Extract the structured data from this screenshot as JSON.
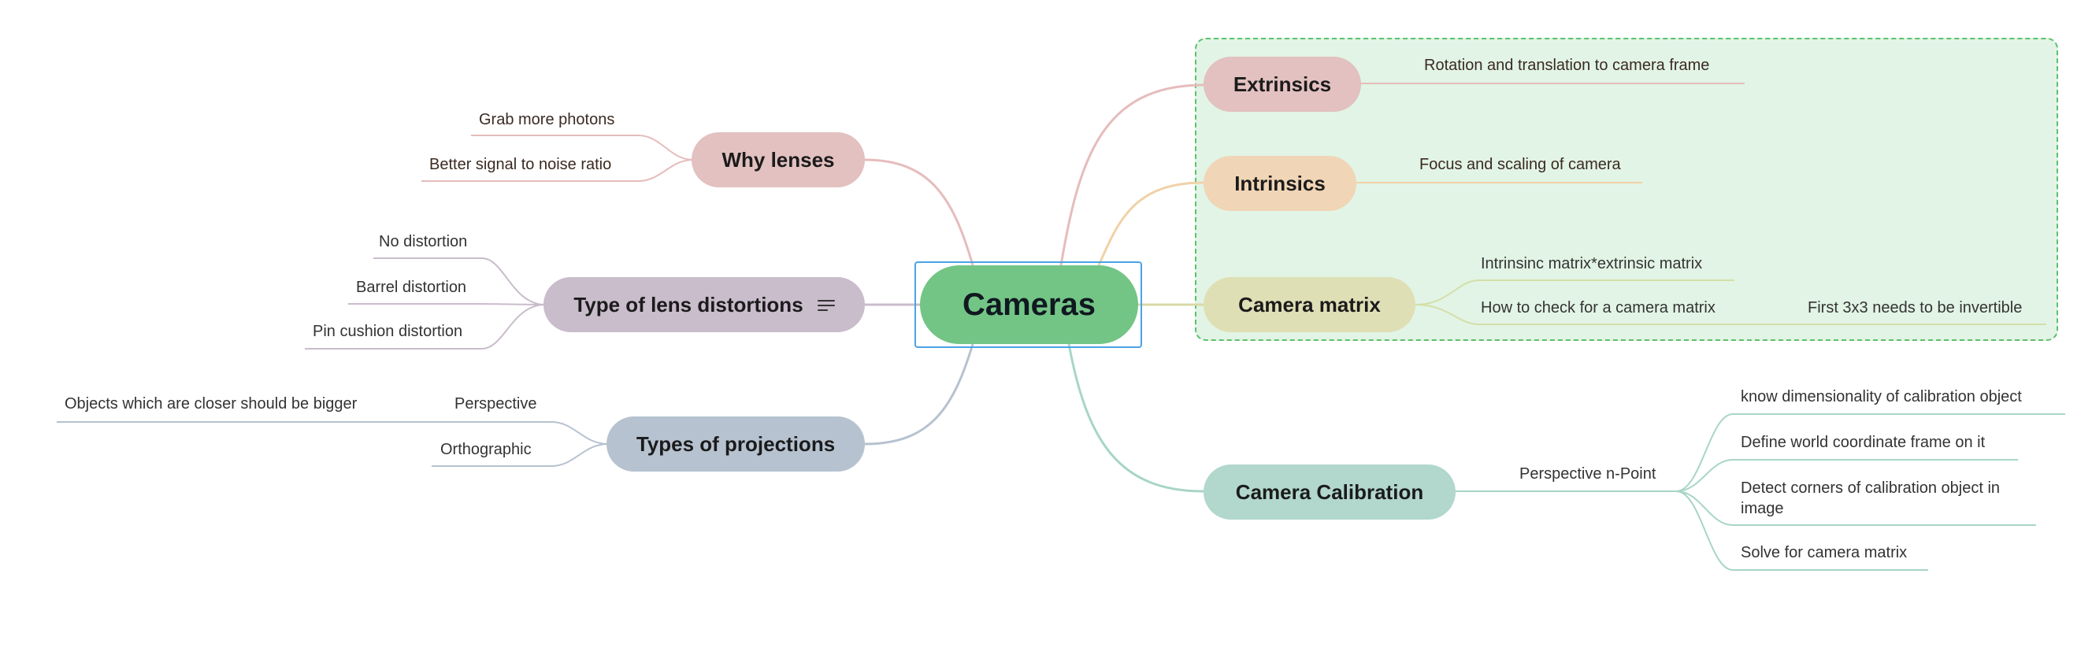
{
  "mindmap": {
    "root": {
      "label": "Cameras"
    },
    "right": {
      "extrinsics": {
        "label": "Extrinsics",
        "children": [
          "Rotation and translation to camera frame"
        ]
      },
      "intrinsics": {
        "label": "Intrinsics",
        "children": [
          "Focus and scaling of camera"
        ]
      },
      "camera_matrix": {
        "label": "Camera matrix",
        "children": [
          "Intrinsinc matrix*extrinsic matrix",
          "How to check for a camera matrix"
        ],
        "grandchild": "First 3x3 needs to be invertible"
      },
      "calibration": {
        "label": "Camera Calibration",
        "child": "Perspective n-Point",
        "grandchildren": [
          "know dimensionality of calibration object",
          "Define world coordinate frame on it",
          "Detect corners of calibration object in image",
          "Solve for camera matrix"
        ]
      }
    },
    "left": {
      "why_lenses": {
        "label": "Why lenses",
        "children": [
          "Grab more photons",
          "Better signal to noise ratio"
        ]
      },
      "distortions": {
        "label": "Type of lens distortions",
        "children": [
          "No distortion",
          "Barrel distortion",
          "Pin cushion distortion"
        ]
      },
      "projections": {
        "label": "Types of projections",
        "children": [
          "Perspective",
          "Orthographic"
        ],
        "grandchild": "Objects which are closer should be bigger"
      }
    }
  },
  "colors": {
    "root_fill": "#73c586",
    "boundary_fill": "#e2f4e5",
    "boundary_stroke": "#5cc06e",
    "extrinsics": "#e2c1c0",
    "intrinsics": "#f0d5b6",
    "camera_matrix": "#dfdfb6",
    "calibration": "#b2d7cc",
    "why_lenses": "#e2c1c0",
    "distortions": "#c9bccb",
    "projections": "#b6c2d0"
  },
  "icons": {
    "distortions_note": "notes-icon"
  }
}
